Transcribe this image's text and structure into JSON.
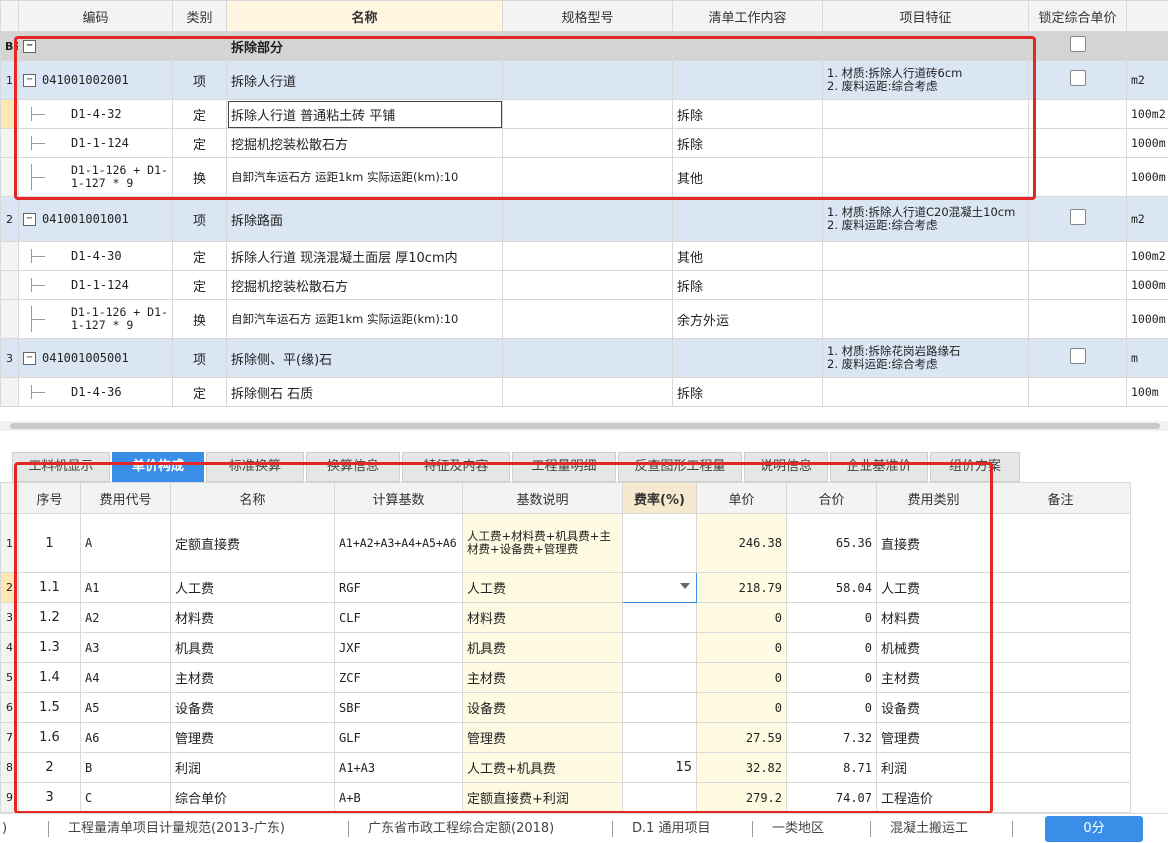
{
  "upper": {
    "headers": [
      "编码",
      "类别",
      "名称",
      "规格型号",
      "清单工作内容",
      "项目特征",
      "锁定综合单价"
    ],
    "rows": [
      {
        "rownum": "B2",
        "code": "",
        "cat": "",
        "name": "拆除部分",
        "spec": "",
        "work": "",
        "feature": "",
        "unit": "",
        "level": 0
      },
      {
        "rownum": "1",
        "code": "041001002001",
        "cat": "项",
        "name": "拆除人行道",
        "spec": "",
        "work": "",
        "feature": "1. 材质:拆除人行道砖6cm\n2. 废料运距:综合考虑",
        "unit": "m2",
        "level": 1
      },
      {
        "rownum": "",
        "code": "D1-4-32",
        "cat": "定",
        "name": "拆除人行道 普通粘土砖 平铺",
        "spec": "",
        "work": "拆除",
        "feature": "",
        "unit": "100m2",
        "level": 2
      },
      {
        "rownum": "",
        "code": "D1-1-124",
        "cat": "定",
        "name": "挖掘机挖装松散石方",
        "spec": "",
        "work": "拆除",
        "feature": "",
        "unit": "1000m",
        "level": 2
      },
      {
        "rownum": "",
        "code": "D1-1-126 + D1-1-127 * 9",
        "cat": "换",
        "name": "自卸汽车运石方 运距1km  实际运距(km):10",
        "spec": "",
        "work": "其他",
        "feature": "",
        "unit": "1000m",
        "level": 2
      },
      {
        "rownum": "2",
        "code": "041001001001",
        "cat": "项",
        "name": "拆除路面",
        "spec": "",
        "work": "",
        "feature": "1. 材质:拆除人行道C20混凝土10cm\n2. 废料运距:综合考虑",
        "unit": "m2",
        "level": 1
      },
      {
        "rownum": "",
        "code": "D1-4-30",
        "cat": "定",
        "name": "拆除人行道 现浇混凝土面层 厚10cm内",
        "spec": "",
        "work": "其他",
        "feature": "",
        "unit": "100m2",
        "level": 2
      },
      {
        "rownum": "",
        "code": "D1-1-124",
        "cat": "定",
        "name": "挖掘机挖装松散石方",
        "spec": "",
        "work": "拆除",
        "feature": "",
        "unit": "1000m",
        "level": 2
      },
      {
        "rownum": "",
        "code": "D1-1-126 + D1-1-127 * 9",
        "cat": "换",
        "name": "自卸汽车运石方 运距1km  实际运距(km):10",
        "spec": "",
        "work": "余方外运",
        "feature": "",
        "unit": "1000m",
        "level": 2
      },
      {
        "rownum": "3",
        "code": "041001005001",
        "cat": "项",
        "name": "拆除侧、平(缘)石",
        "spec": "",
        "work": "",
        "feature": "1. 材质:拆除花岗岩路缘石\n2. 废料运距:综合考虑",
        "unit": "m",
        "level": 1
      },
      {
        "rownum": "",
        "code": "D1-4-36",
        "cat": "定",
        "name": "拆除侧石 石质",
        "spec": "",
        "work": "拆除",
        "feature": "",
        "unit": "100m",
        "level": 2
      }
    ]
  },
  "tabs": [
    "工料机显示",
    "单价构成",
    "标准换算",
    "换算信息",
    "特征及内容",
    "工程量明细",
    "反查图形工程量",
    "说明信息",
    "企业基准价",
    "组价方案"
  ],
  "active_tab": "单价构成",
  "lower": {
    "headers": [
      "序号",
      "费用代号",
      "名称",
      "计算基数",
      "基数说明",
      "费率(%)",
      "单价",
      "合价",
      "费用类别",
      "备注"
    ],
    "rows": [
      {
        "rownum": "1",
        "seq": "1",
        "code": "A",
        "name": "定额直接费",
        "base": "A1+A2+A3+A4+A5+A6",
        "desc": "人工费+材料费+机具费+主材费+设备费+管理费",
        "rate": "",
        "price": "246.38",
        "total": "65.36",
        "type": "直接费",
        "note": ""
      },
      {
        "rownum": "2",
        "seq": "1.1",
        "code": "A1",
        "name": "人工费",
        "base": "RGF",
        "desc": "人工费",
        "rate": "",
        "price": "218.79",
        "total": "58.04",
        "type": "人工费",
        "note": ""
      },
      {
        "rownum": "3",
        "seq": "1.2",
        "code": "A2",
        "name": "材料费",
        "base": "CLF",
        "desc": "材料费",
        "rate": "",
        "price": "0",
        "total": "0",
        "type": "材料费",
        "note": ""
      },
      {
        "rownum": "4",
        "seq": "1.3",
        "code": "A3",
        "name": "机具费",
        "base": "JXF",
        "desc": "机具费",
        "rate": "",
        "price": "0",
        "total": "0",
        "type": "机械费",
        "note": ""
      },
      {
        "rownum": "5",
        "seq": "1.4",
        "code": "A4",
        "name": "主材费",
        "base": "ZCF",
        "desc": "主材费",
        "rate": "",
        "price": "0",
        "total": "0",
        "type": "主材费",
        "note": ""
      },
      {
        "rownum": "6",
        "seq": "1.5",
        "code": "A5",
        "name": "设备费",
        "base": "SBF",
        "desc": "设备费",
        "rate": "",
        "price": "0",
        "total": "0",
        "type": "设备费",
        "note": ""
      },
      {
        "rownum": "7",
        "seq": "1.6",
        "code": "A6",
        "name": "管理费",
        "base": "GLF",
        "desc": "管理费",
        "rate": "",
        "price": "27.59",
        "total": "7.32",
        "type": "管理费",
        "note": ""
      },
      {
        "rownum": "8",
        "seq": "2",
        "code": "B",
        "name": "利润",
        "base": "A1+A3",
        "desc": "人工费+机具费",
        "rate": "15",
        "price": "32.82",
        "total": "8.71",
        "type": "利润",
        "note": ""
      },
      {
        "rownum": "9",
        "seq": "3",
        "code": "C",
        "name": "综合单价",
        "base": "A+B",
        "desc": "定额直接费+利润",
        "rate": "",
        "price": "279.2",
        "total": "74.07",
        "type": "工程造价",
        "note": ""
      }
    ]
  },
  "status": {
    "items": [
      ")",
      "工程量清单项目计量规范(2013-广东)",
      "广东省市政工程综合定额(2018)",
      "D.1 通用项目",
      "一类地区",
      "混凝土搬运工"
    ],
    "button": "0分"
  },
  "colors": {
    "accent": "#3b8ee8",
    "highlight": "#e32626",
    "group_row": "#dbe6f4"
  }
}
